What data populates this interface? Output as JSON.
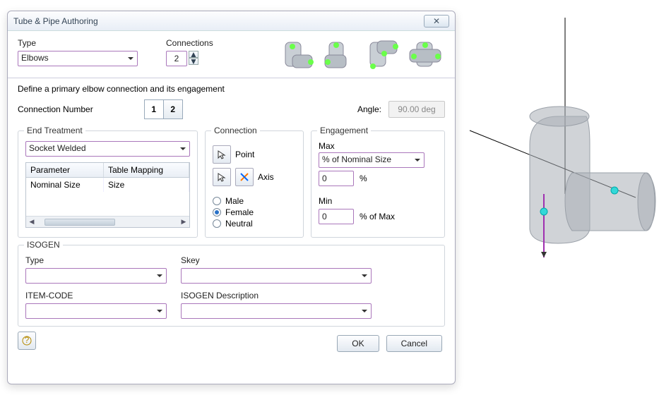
{
  "dialog": {
    "title": "Tube & Pipe Authoring",
    "type_label": "Type",
    "type_value": "Elbows",
    "connections_label": "Connections",
    "connections_value": "2",
    "instruction": "Define a primary elbow connection and its engagement",
    "conn_num_label": "Connection Number",
    "conn_buttons": [
      "1",
      "2"
    ],
    "angle_label": "Angle:",
    "angle_value": "90.00 deg"
  },
  "end_treatment": {
    "legend": "End Treatment",
    "value": "Socket Welded",
    "table": {
      "headers": [
        "Parameter",
        "Table Mapping"
      ],
      "row": [
        "Nominal Size",
        "Size"
      ]
    }
  },
  "connection": {
    "legend": "Connection",
    "point_label": "Point",
    "axis_label": "Axis",
    "gender": {
      "male": "Male",
      "female": "Female",
      "neutral": "Neutral",
      "selected": "female"
    }
  },
  "engagement": {
    "legend": "Engagement",
    "max_label": "Max",
    "max_type": "% of Nominal Size",
    "max_value": "0",
    "max_unit": "%",
    "min_label": "Min",
    "min_value": "0",
    "min_unit": "% of Max"
  },
  "isogen": {
    "legend": "ISOGEN",
    "type_label": "Type",
    "type_value": "",
    "skey_label": "Skey",
    "skey_value": "",
    "item_code_label": "ITEM-CODE",
    "item_code_value": "",
    "desc_label": "ISOGEN Description",
    "desc_value": ""
  },
  "buttons": {
    "ok": "OK",
    "cancel": "Cancel",
    "help_icon": "?"
  },
  "icons": {
    "close": "✕",
    "up": "▲",
    "down": "▼"
  }
}
